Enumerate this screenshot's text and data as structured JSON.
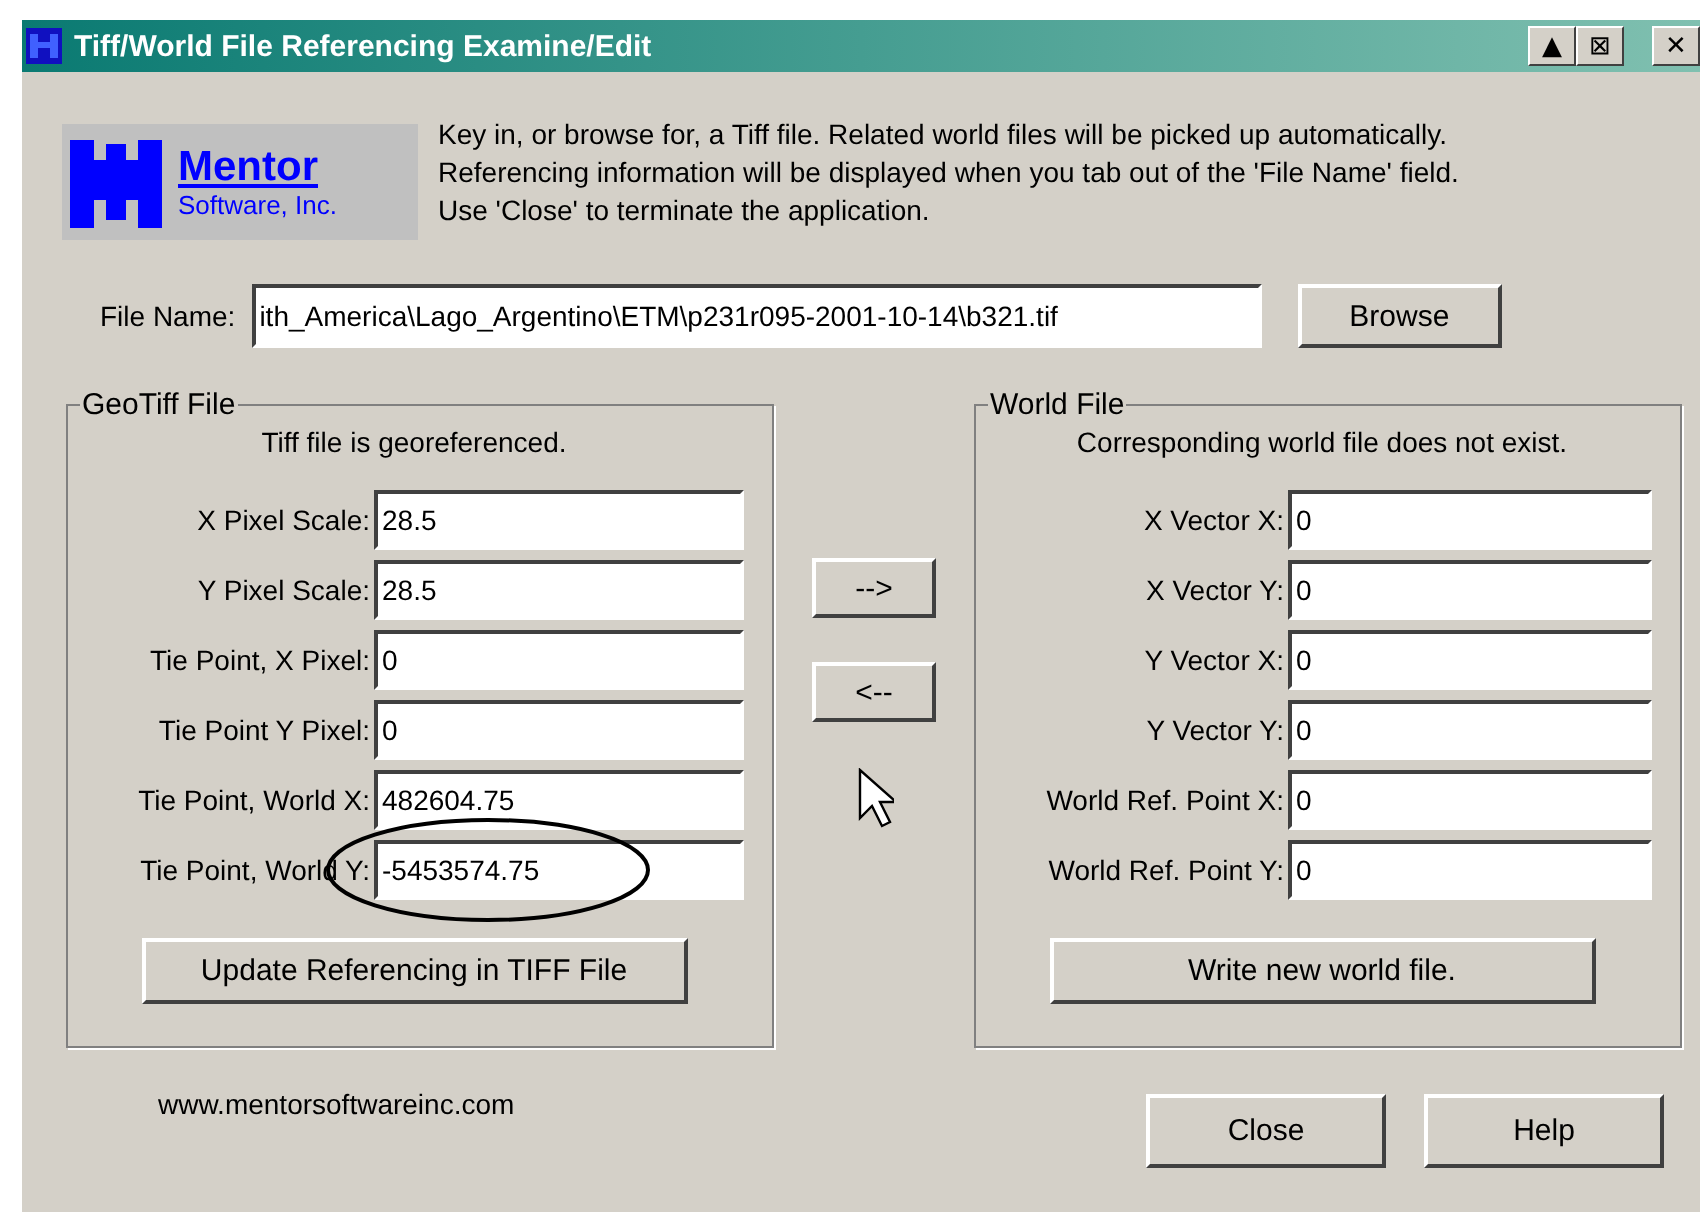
{
  "window": {
    "title": "Tiff/World File Referencing Examine/Edit",
    "controls": [
      "▲",
      "⊠",
      "✕"
    ]
  },
  "logo": {
    "name": "Mentor",
    "subtitle": "Software, Inc."
  },
  "instructions": [
    "Key in, or browse for, a Tiff file.  Related world files will be picked up automatically.",
    "Referencing information will be displayed when you tab out of the 'File Name' field.",
    "Use 'Close' to terminate the application."
  ],
  "file_name": {
    "label": "File Name:",
    "value": "ith_America\\Lago_Argentino\\ETM\\p231r095-2001-10-14\\b321.tif",
    "button": "Browse"
  },
  "geotiff": {
    "title": "GeoTiff File",
    "status": "Tiff file is georeferenced.",
    "fields": [
      {
        "label": "X Pixel Scale:",
        "value": "28.5",
        "highlighted": false
      },
      {
        "label": "Y Pixel Scale:",
        "value": "28.5",
        "highlighted": false
      },
      {
        "label": "Tie Point, X Pixel:",
        "value": "0",
        "highlighted": false
      },
      {
        "label": "Tie Point Y Pixel:",
        "value": "0",
        "highlighted": false
      },
      {
        "label": "Tie Point, World X:",
        "value": "482604.75",
        "highlighted": false
      },
      {
        "label": "Tie Point, World Y:",
        "value": "-5453574.75",
        "highlighted": true
      }
    ],
    "button": "Update Referencing in TIFF File"
  },
  "copy_buttons": [
    "-->",
    "<--"
  ],
  "world": {
    "title": "World File",
    "status": "Corresponding world file does not exist.",
    "fields": [
      {
        "label": "X Vector X:",
        "value": "0"
      },
      {
        "label": "X Vector Y:",
        "value": "0"
      },
      {
        "label": "Y Vector X:",
        "value": "0"
      },
      {
        "label": "Y Vector Y:",
        "value": "0"
      },
      {
        "label": "World Ref. Point X:",
        "value": "0"
      },
      {
        "label": "World Ref. Point Y:",
        "value": "0"
      }
    ],
    "button": "Write new world file."
  },
  "footer": {
    "url": "www.mentorsoftwareinc.com",
    "buttons": [
      "Close",
      "Help"
    ]
  }
}
